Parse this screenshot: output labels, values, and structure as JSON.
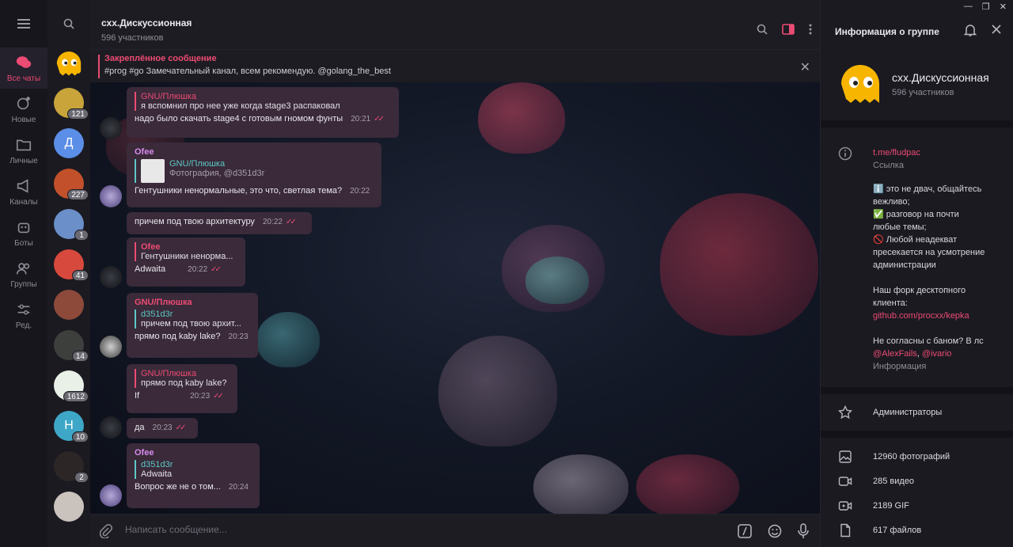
{
  "folders": [
    {
      "label": "Все чаты",
      "icon": "chats-icon",
      "active": true
    },
    {
      "label": "Новые",
      "icon": "new-chat-icon"
    },
    {
      "label": "Личные",
      "icon": "folder-icon"
    },
    {
      "label": "Каналы",
      "icon": "megaphone-icon"
    },
    {
      "label": "Боты",
      "icon": "bot-icon"
    },
    {
      "label": "Группы",
      "icon": "group-icon"
    },
    {
      "label": "Ред.",
      "icon": "edit-folders-icon"
    }
  ],
  "chats": [
    {
      "badge": "",
      "color": "#f7b500"
    },
    {
      "badge": "121",
      "color": "#c8a43a"
    },
    {
      "badge": "",
      "color": "#5b8ee6",
      "letter": "Д"
    },
    {
      "badge": "227",
      "color": "#c2512b"
    },
    {
      "badge": "1",
      "color": "#6b8fc8"
    },
    {
      "badge": "41",
      "color": "#d8493d"
    },
    {
      "badge": "",
      "color": "#8d4a3a"
    },
    {
      "badge": "14",
      "color": "#3d3f3d"
    },
    {
      "badge": "1612",
      "color": "#e8f0e8"
    },
    {
      "badge": "10",
      "color": "#3ea7c8",
      "letter": "H"
    },
    {
      "badge": "2",
      "color": "#2c2627"
    },
    {
      "badge": "",
      "color": "#c9c2bd"
    }
  ],
  "header": {
    "title": "схх.Дискуссионная",
    "subtitle": "596 участников"
  },
  "pinned": {
    "title": "Закреплённое сообщение",
    "text": "#prog #go  Замечательный канал, всем рекомендую.  @golang_the_best"
  },
  "messages": [
    {
      "author": "GNU/Плюшка",
      "text1": "я вспомнил про нее уже когда stage3 распаковал",
      "text2": "надо было скачать stage4 с готовым гномом фунты",
      "time": "20:21"
    },
    {
      "author": "Ofee",
      "reply_name": "GNU/Плюшка",
      "reply_text": "Фотография, @d351d3r",
      "text": "Гентушники ненормальные, это что, светлая тема?",
      "time": "20:22"
    },
    {
      "text": "причем под твою архитектуру",
      "time": "20:22"
    },
    {
      "reply_name": "Ofee",
      "reply_text": "Гентушники ненорма...",
      "text": "Adwaita",
      "time": "20:22"
    },
    {
      "author": "GNU/Плюшка",
      "reply_name": "d351d3r",
      "reply_text": "причем под твою архит...",
      "text": "прямо под kaby lake?",
      "time": "20:23"
    },
    {
      "reply_name": "GNU/Плюшка",
      "reply_text": "прямо под kaby lake?",
      "text": "If",
      "time": "20:23"
    },
    {
      "text": "да",
      "time": "20:23"
    },
    {
      "author": "Ofee",
      "reply_name": "d351d3r",
      "reply_text": "Adwaita",
      "text": "Вопрос же не о том...",
      "time": "20:24"
    }
  ],
  "composer": {
    "placeholder": "Написать сообщение..."
  },
  "info": {
    "header": "Информация о группе",
    "name": "схх.Дискуссионная",
    "members": "596 участников",
    "link": "t.me/fludpac",
    "link_label": "Ссылка",
    "desc1": "ℹ️ это не двач, общайтесь",
    "desc2": "вежливо;",
    "desc3": "✅ разговор на почти",
    "desc4": "любые темы;",
    "desc5": "🚫 Любой неадекват",
    "desc6": "пресекается на усмотрение",
    "desc7": "администрации",
    "desc8": "Наш форк десктопного",
    "desc9": "клиента:",
    "desc10": "github.com/procxx/kepka",
    "desc11": "Не согласны с баном? В лс",
    "desc12a": "@AlexFails",
    "desc12b": ", ",
    "desc12c": "@ivario",
    "desc_label": "Информация",
    "admins": "Администраторы",
    "photos": "12960 фотографий",
    "videos": "285 видео",
    "gifs": "2189 GIF",
    "files": "617 файлов"
  }
}
